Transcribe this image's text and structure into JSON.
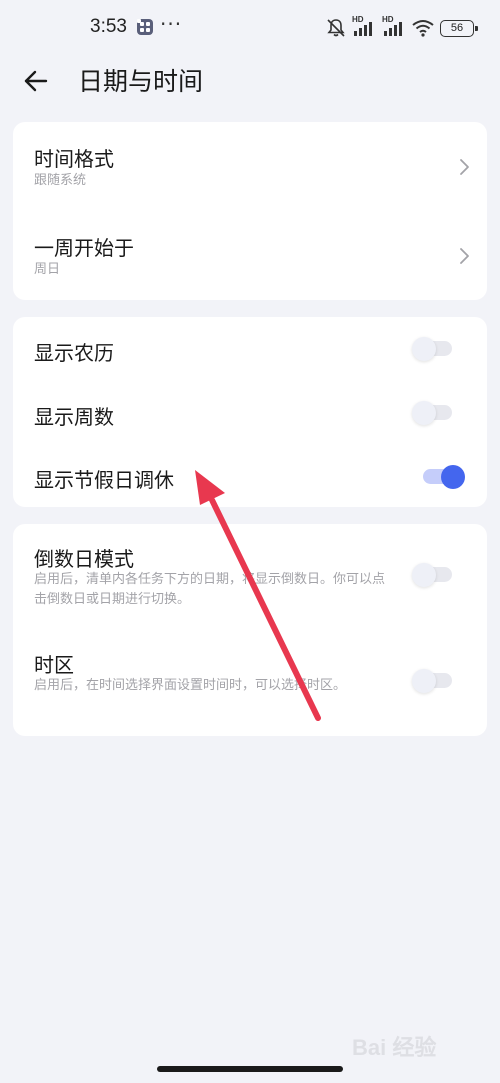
{
  "status_bar": {
    "time": "3:53",
    "more": "···",
    "battery": "56",
    "signal_label_1": "HD",
    "signal_label_2": "HD"
  },
  "header": {
    "title": "日期与时间"
  },
  "group_format": {
    "items": [
      {
        "title": "时间格式",
        "value": "跟随系统"
      },
      {
        "title": "一周开始于",
        "value": "周日"
      }
    ]
  },
  "group_display": {
    "items": [
      {
        "title": "显示农历",
        "enabled": false
      },
      {
        "title": "显示周数",
        "enabled": false
      },
      {
        "title": "显示节假日调休",
        "enabled": true
      }
    ]
  },
  "group_mode": {
    "items": [
      {
        "title": "倒数日模式",
        "desc": "启用后，清单内各任务下方的日期，将显示倒数日。你可以点击倒数日或日期进行切换。",
        "enabled": false
      },
      {
        "title": "时区",
        "desc": "启用后，在时间选择界面设置时间时，可以选择时区。",
        "enabled": false
      }
    ]
  },
  "watermark": "Bai 经验",
  "colors": {
    "accent": "#4466ee",
    "annotation": "#e8384f",
    "background": "#f2f3f8"
  }
}
